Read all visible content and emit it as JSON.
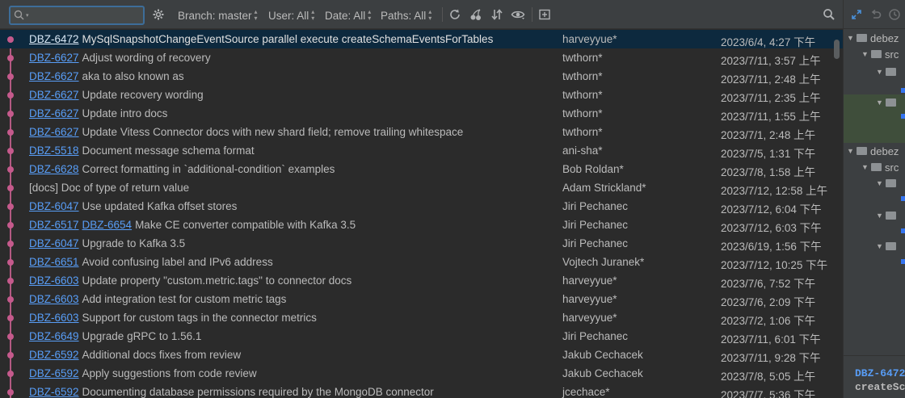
{
  "toolbar": {
    "search_value": "",
    "branch_label": "Branch: master",
    "user_label": "User: All",
    "date_label": "Date: All",
    "paths_label": "Paths: All",
    "icons": [
      "search-icon",
      "gear-icon",
      "refresh-icon",
      "cherry-pick-icon",
      "sort-icon",
      "eye-icon",
      "new-tab-icon",
      "find-icon"
    ]
  },
  "colors": {
    "background": "#2b2b2b",
    "toolbar": "#3c3f41",
    "selected_row": "#0d293e",
    "link": "#589df6",
    "graph": "#c55a8c"
  },
  "commits": [
    {
      "issues": [
        "DBZ-6472"
      ],
      "message": "MySqlSnapshotChangeEventSource parallel execute createSchemaEventsForTables",
      "author": "harveyyue*",
      "date": "2023/6/4, 4:27 下午",
      "selected": true
    },
    {
      "issues": [
        "DBZ-6627"
      ],
      "message": "Adjust wording of recovery",
      "author": "twthorn*",
      "date": "2023/7/11, 3:57 上午"
    },
    {
      "issues": [
        "DBZ-6627"
      ],
      "message": "aka to also known as",
      "author": "twthorn*",
      "date": "2023/7/11, 2:48 上午"
    },
    {
      "issues": [
        "DBZ-6627"
      ],
      "message": "Update recovery wording",
      "author": "twthorn*",
      "date": "2023/7/11, 2:35 上午"
    },
    {
      "issues": [
        "DBZ-6627"
      ],
      "message": "Update intro docs",
      "author": "twthorn*",
      "date": "2023/7/11, 1:55 上午"
    },
    {
      "issues": [
        "DBZ-6627"
      ],
      "message": "Update Vitess Connector docs with new shard field; remove trailing whitespace",
      "author": "twthorn*",
      "date": "2023/7/1, 2:48 上午"
    },
    {
      "issues": [
        "DBZ-5518"
      ],
      "message": "Document message schema format",
      "author": "ani-sha*",
      "date": "2023/7/5, 1:31 下午"
    },
    {
      "issues": [
        "DBZ-6628"
      ],
      "message": "Correct formatting in `additional-condition` examples",
      "author": "Bob Roldan*",
      "date": "2023/7/8, 1:58 上午"
    },
    {
      "issues": [],
      "message": "[docs] Doc of type of return value",
      "author": "Adam Strickland*",
      "date": "2023/7/12, 12:58 上午"
    },
    {
      "issues": [
        "DBZ-6047"
      ],
      "message": "Use updated Kafka offset stores",
      "author": "Jiri Pechanec",
      "date": "2023/7/12, 6:04 下午"
    },
    {
      "issues": [
        "DBZ-6517",
        "DBZ-6654"
      ],
      "message": "Make CE converter compatible with Kafka 3.5",
      "author": "Jiri Pechanec",
      "date": "2023/7/12, 6:03 下午"
    },
    {
      "issues": [
        "DBZ-6047"
      ],
      "message": "Upgrade to Kafka 3.5",
      "author": "Jiri Pechanec",
      "date": "2023/6/19, 1:56 下午"
    },
    {
      "issues": [
        "DBZ-6651"
      ],
      "message": "Avoid confusing label and IPv6 address",
      "author": "Vojtech Juranek*",
      "date": "2023/7/12, 10:25 下午"
    },
    {
      "issues": [
        "DBZ-6603"
      ],
      "message": "Update property \"custom.metric.tags\" to connector docs",
      "author": "harveyyue*",
      "date": "2023/7/6, 7:52 下午"
    },
    {
      "issues": [
        "DBZ-6603"
      ],
      "message": "Add integration test for custom metric tags",
      "author": "harveyyue*",
      "date": "2023/7/6, 2:09 下午"
    },
    {
      "issues": [
        "DBZ-6603"
      ],
      "message": "Support for custom tags in the connector metrics",
      "author": "harveyyue*",
      "date": "2023/7/2, 1:06 下午"
    },
    {
      "issues": [
        "DBZ-6649"
      ],
      "message": "Upgrade gRPC to 1.56.1",
      "author": "Jiri Pechanec",
      "date": "2023/7/11, 6:01 下午"
    },
    {
      "issues": [
        "DBZ-6592"
      ],
      "message": "Additional docs fixes from review",
      "author": "Jakub Cechacek",
      "date": "2023/7/11, 9:28 下午"
    },
    {
      "issues": [
        "DBZ-6592"
      ],
      "message": "Apply suggestions from code review",
      "author": "Jakub Cechacek",
      "date": "2023/7/8, 5:05 上午"
    },
    {
      "issues": [
        "DBZ-6592"
      ],
      "message": "Documenting database permissions required by the MongoDB connector",
      "author": "jcechace*",
      "date": "2023/7/7, 5:36 下午"
    }
  ],
  "right_panel": {
    "tree": [
      {
        "label": "debez",
        "level": 0,
        "expanded": true,
        "top": 0
      },
      {
        "label": "src",
        "level": 1,
        "expanded": true,
        "top": 0
      },
      {
        "label": "",
        "level": 2,
        "expanded": true,
        "top": 0
      },
      {
        "label": "",
        "level": 2,
        "expanded": true,
        "top": 0
      },
      {
        "label": "debez",
        "level": 0,
        "expanded": true,
        "top": 0
      },
      {
        "label": "src",
        "level": 1,
        "expanded": true,
        "top": 0
      },
      {
        "label": "",
        "level": 2,
        "expanded": true,
        "top": 0
      },
      {
        "label": "",
        "level": 2,
        "expanded": true,
        "top": 0
      },
      {
        "label": "",
        "level": 2,
        "expanded": true,
        "top": 0
      }
    ],
    "detail_issue": "DBZ-6472",
    "detail_text": "createSc"
  }
}
